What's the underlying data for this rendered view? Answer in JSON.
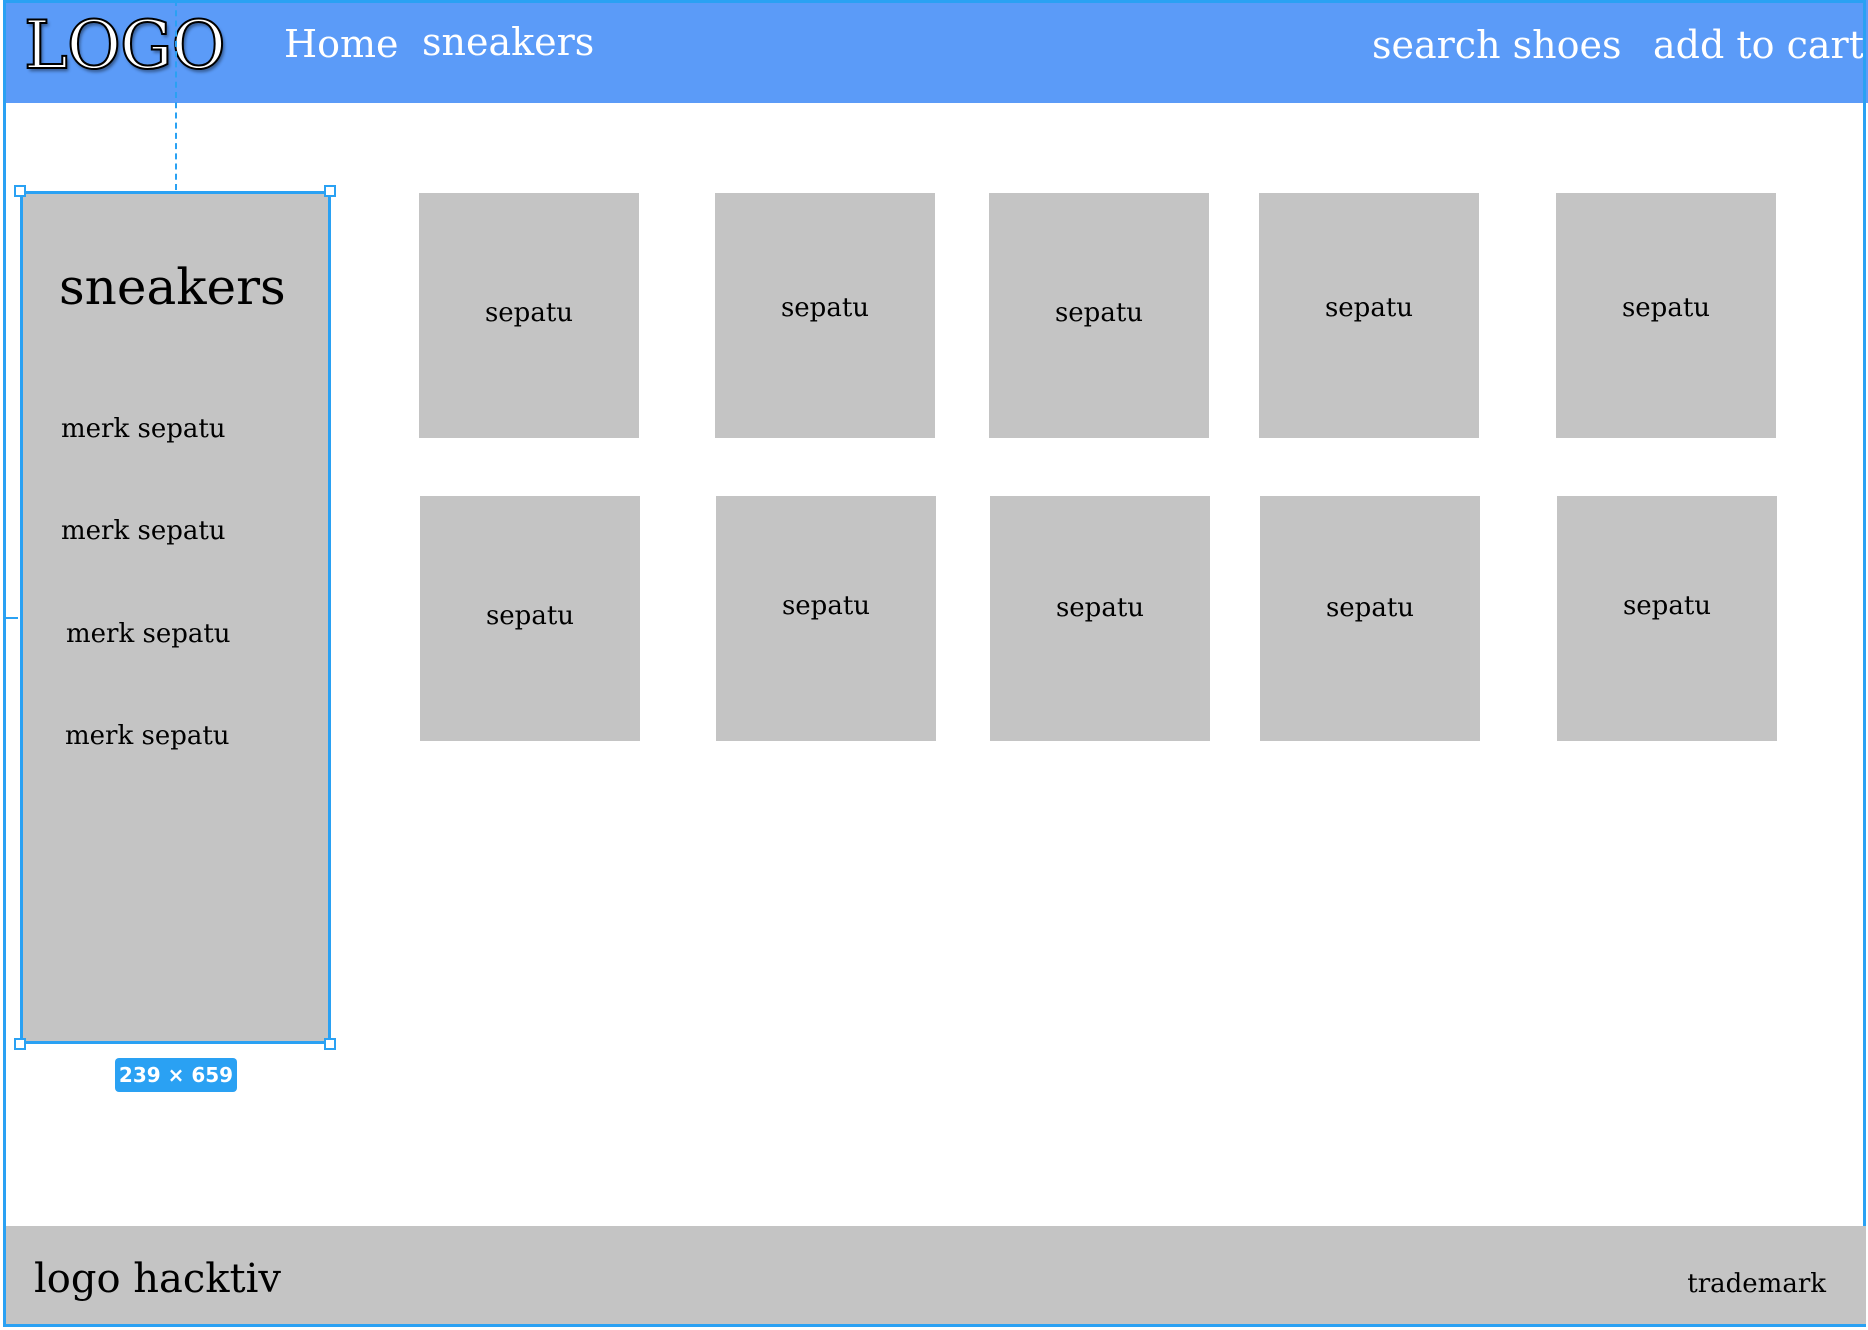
{
  "header": {
    "logo": "LOGO",
    "nav": {
      "home": "Home",
      "sneakers": "sneakers",
      "search": "search shoes",
      "cart": "add to cart"
    }
  },
  "sidebar": {
    "title": "sneakers",
    "items": [
      "merk sepatu",
      "merk sepatu",
      "merk sepatu",
      "merk sepatu"
    ],
    "dimension_badge": "239 × 659"
  },
  "products": {
    "rows": [
      [
        "sepatu",
        "sepatu",
        "sepatu",
        "sepatu",
        "sepatu"
      ],
      [
        "sepatu",
        "sepatu",
        "sepatu",
        "sepatu",
        "sepatu"
      ]
    ]
  },
  "footer": {
    "logo": "logo hacktiv",
    "trademark": "trademark"
  },
  "colors": {
    "header": "#5b9bf8",
    "selection": "#2aa1f3",
    "placeholder": "#c4c4c4"
  }
}
